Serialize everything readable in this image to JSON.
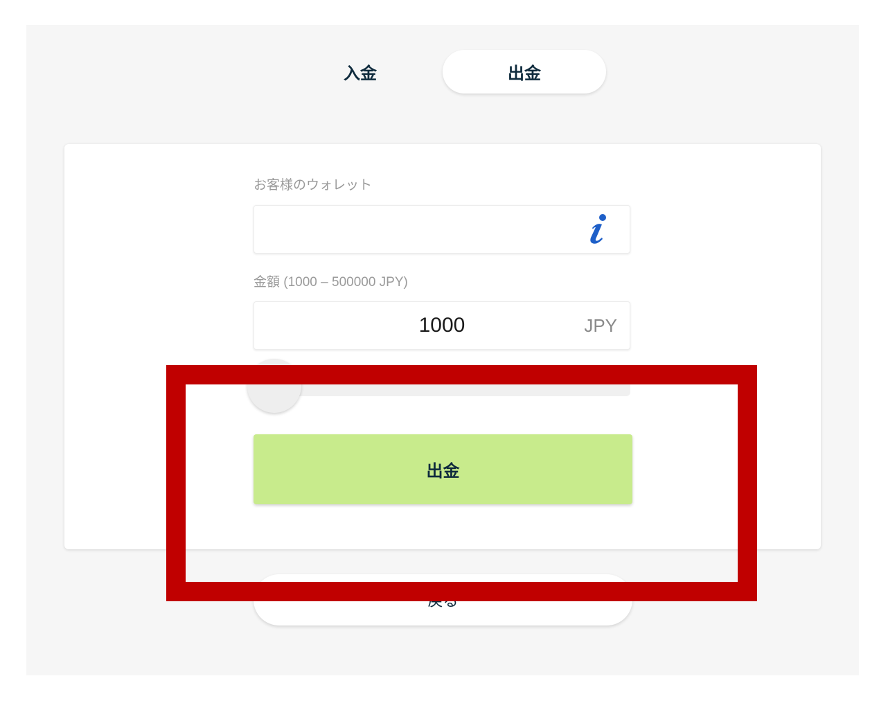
{
  "tabs": {
    "deposit_label": "入金",
    "withdraw_label": "出金",
    "active": "withdraw"
  },
  "form": {
    "wallet_label": "お客様のウォレット",
    "wallet_value": "",
    "info_icon": "info-icon",
    "amount_label": "金額 (1000 – 500000 JPY)",
    "amount_value": "1000",
    "currency": "JPY",
    "slider_fraction": 0.0,
    "submit_label": "出金"
  },
  "back_label": "戻る",
  "colors": {
    "accent_button": "#c8eb8c",
    "text_dark": "#0f2b3d",
    "info_icon": "#1e5fc8",
    "highlight": "#c00000"
  }
}
